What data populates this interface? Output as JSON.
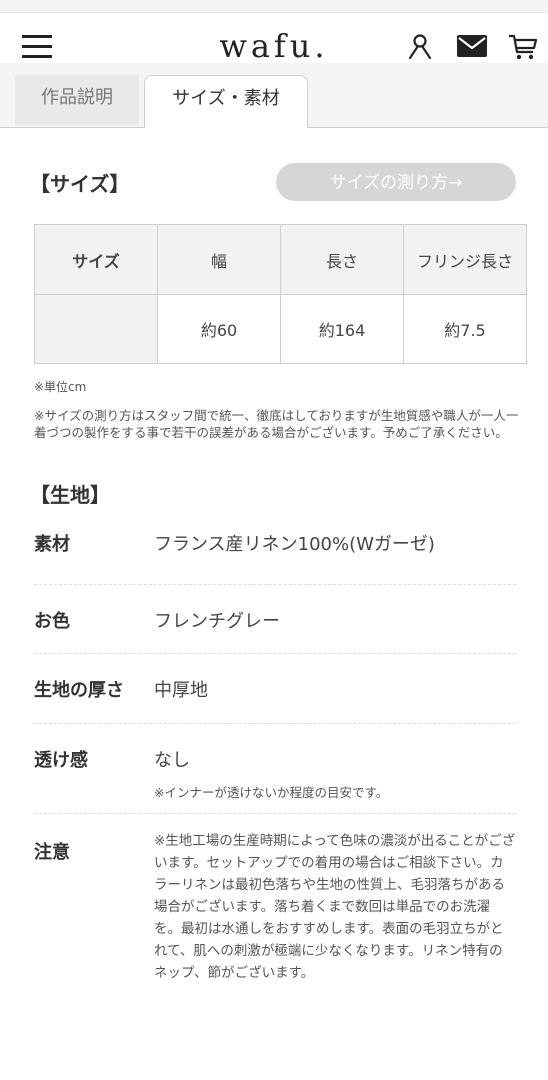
{
  "header": {
    "logo": "wafu.",
    "icons": [
      "menu-icon",
      "user-icon",
      "mail-icon",
      "cart-icon"
    ]
  },
  "tabs": [
    {
      "label": "作品説明",
      "active": false
    },
    {
      "label": "サイズ・素材",
      "active": true
    }
  ],
  "size_section": {
    "title": "【サイズ】",
    "measure_button": "サイズの測り方→",
    "table": {
      "headers": [
        "サイズ",
        "幅",
        "長さ",
        "フリンジ長さ"
      ],
      "rows": [
        [
          "",
          "約60",
          "約164",
          "約7.5"
        ]
      ]
    },
    "unit_note": "※単位cm",
    "measure_note": "※サイズの測り方はスタッフ間で統一、徹底はしておりますが生地質感や職人が一人一着づつの製作をする事で若干の誤差がある場合がございます。予めご了承ください。"
  },
  "fabric_section": {
    "title": "【生地】",
    "rows": [
      {
        "label": "素材",
        "value": "フランス産リネン100%(Wガーゼ)"
      },
      {
        "label": "お色",
        "value": "フレンチグレー"
      },
      {
        "label": "生地の厚さ",
        "value": "中厚地"
      },
      {
        "label": "透け感",
        "value": "なし",
        "sub": "※インナーが透けないか程度の目安です。"
      },
      {
        "label": "注意",
        "value": "※生地工場の生産時期によって色味の濃淡が出ることがございます。セットアップでの着用の場合はご相談下さい。カラーリネンは最初色落ちや生地の性質上、毛羽落ちがある場合がございます。落ち着くまで数回は単品でのお洗濯を。最初は水通しをおすすめします。表面の毛羽立ちがとれて、肌への刺激が極端に少なくなります。リネン特有のネップ、節がございます。"
      }
    ]
  },
  "colors": {
    "text": "#333333",
    "border": "#cfcfcf",
    "header_cell": "#f2f2f2",
    "button_bg": "#d6d6d6",
    "tab_bg": "#e9e9e9"
  }
}
